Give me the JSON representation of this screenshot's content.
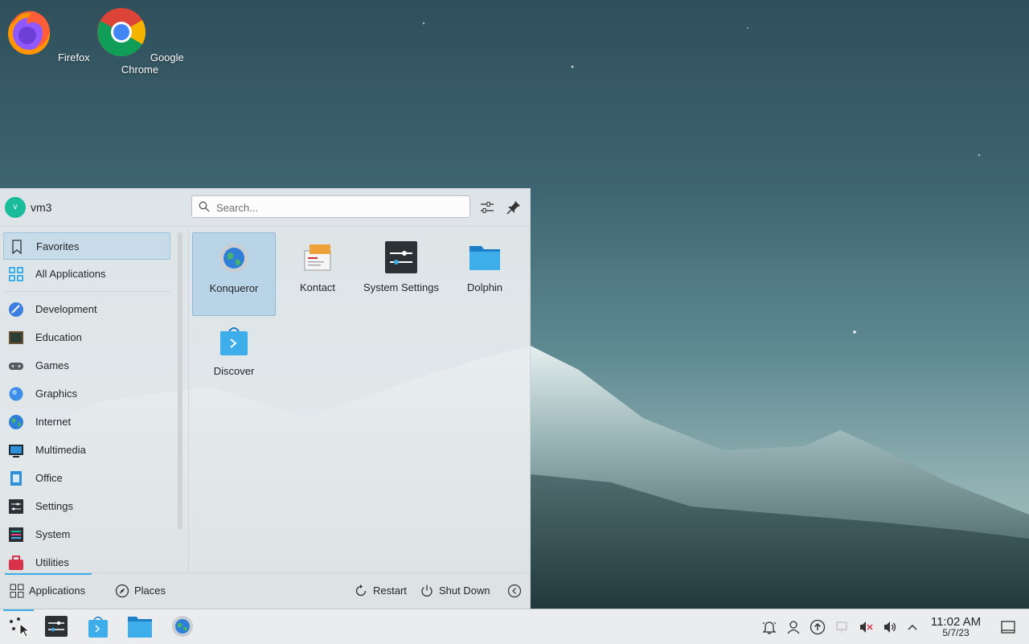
{
  "desktop": {
    "icons": [
      {
        "label": "Firefox",
        "icon": "firefox-icon"
      },
      {
        "label": "Google Chrome",
        "icon": "chrome-icon"
      }
    ]
  },
  "launcher": {
    "user": {
      "initial": "v",
      "name": "vm3"
    },
    "search": {
      "placeholder": "Search..."
    },
    "categories": [
      {
        "label": "Favorites",
        "icon": "bookmark-icon",
        "selected": true
      },
      {
        "label": "All Applications",
        "icon": "grid-apps-icon"
      },
      {
        "label": "Development",
        "icon": "development-icon"
      },
      {
        "label": "Education",
        "icon": "education-icon"
      },
      {
        "label": "Games",
        "icon": "gamepad-icon"
      },
      {
        "label": "Graphics",
        "icon": "graphics-icon"
      },
      {
        "label": "Internet",
        "icon": "globe-icon"
      },
      {
        "label": "Multimedia",
        "icon": "multimedia-icon"
      },
      {
        "label": "Office",
        "icon": "office-icon"
      },
      {
        "label": "Settings",
        "icon": "settings-icon"
      },
      {
        "label": "System",
        "icon": "system-icon"
      },
      {
        "label": "Utilities",
        "icon": "toolbox-icon"
      }
    ],
    "favorites": [
      {
        "label": "Konqueror",
        "icon": "konqueror-icon",
        "selected": true
      },
      {
        "label": "Kontact",
        "icon": "kontact-icon"
      },
      {
        "label": "System Settings",
        "icon": "system-settings-icon"
      },
      {
        "label": "Dolphin",
        "icon": "dolphin-folder-icon"
      },
      {
        "label": "Discover",
        "icon": "discover-icon"
      }
    ],
    "footer": {
      "applications": "Applications",
      "places": "Places",
      "restart": "Restart",
      "shutdown": "Shut Down"
    }
  },
  "taskbar": {
    "clock": {
      "time": "11:02 AM",
      "date": "5/7/23"
    }
  },
  "colors": {
    "accent": "#3daee9",
    "selection": "#c8dbe8",
    "avatar": "#1abc9c"
  }
}
